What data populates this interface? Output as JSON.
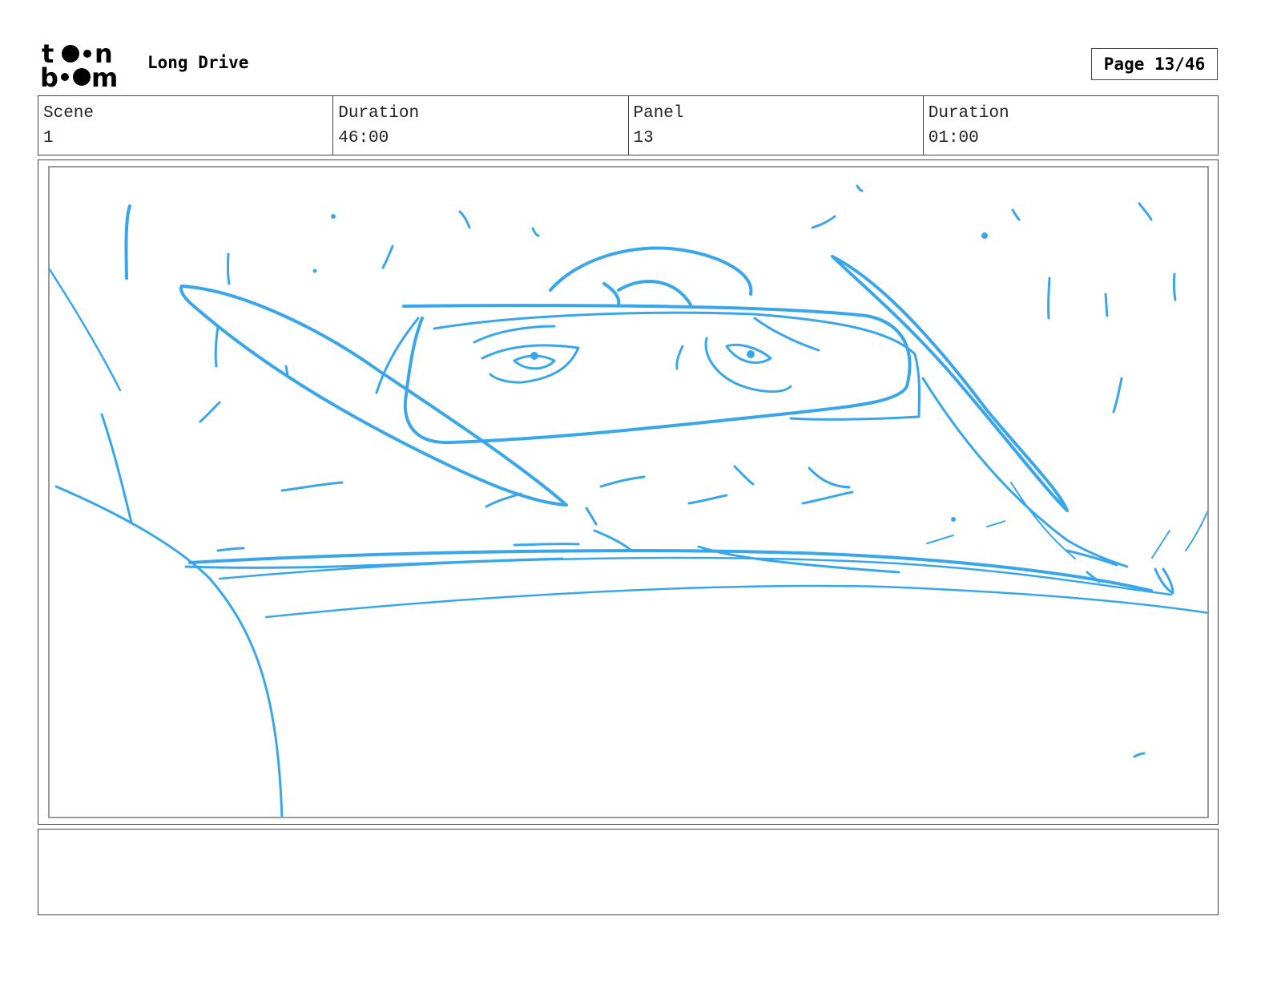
{
  "header": {
    "logo_top": "to n",
    "logo_bottom": "b  m",
    "project_title": "Long Drive",
    "page_label": "Page 13/46"
  },
  "info": {
    "scene_label": "Scene",
    "scene_value": "1",
    "scene_duration_label": "Duration",
    "scene_duration_value": "46:00",
    "panel_label": "Panel",
    "panel_value": "13",
    "panel_duration_label": "Duration",
    "panel_duration_value": "01:00"
  },
  "sketch": {
    "stroke_color": "#3aa6ea"
  },
  "caption": {
    "text": ""
  }
}
